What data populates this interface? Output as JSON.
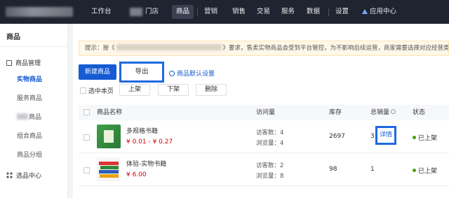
{
  "topnav": {
    "items": [
      "工作台",
      "门店",
      "商品",
      "营销",
      "销售",
      "交易",
      "服务",
      "数据",
      "设置",
      "应用中心"
    ],
    "active": "商品"
  },
  "sidebar": {
    "title": "商品",
    "group1": "商品管理",
    "items": [
      "实物商品",
      "服务商品",
      "商品",
      "组合商品",
      "商品分组"
    ],
    "group2": "选品中心"
  },
  "notice": {
    "prefix": "提示：按《",
    "suffix": "》要求，售卖实物商品会受到平台管控，为不影响后续运营，商家需要选择对应经营类目，特殊类目需"
  },
  "toolbar": {
    "new_label": "新建商品",
    "export_label": "导出",
    "settings_label": "商品默认设置",
    "select_page_label": "选中本页",
    "shelve_label": "上架",
    "unshelve_label": "下架",
    "delete_label": "删除"
  },
  "table": {
    "headers": {
      "name": "商品名称",
      "visits": "访问量",
      "stock": "库存",
      "sales": "总销量",
      "status": "状态"
    },
    "rows": [
      {
        "name": "多规格书籍",
        "price": "¥ 0.01 - ¥ 0.27",
        "visitors": "访客数：4",
        "views": "浏览量：4",
        "stock": "2697",
        "sales": "3",
        "detail": "详情",
        "status": "已上架"
      },
      {
        "name": "体验-实物书籍",
        "price": "¥ 6.00",
        "visitors": "访客数：2",
        "views": "浏览量：8",
        "stock": "98",
        "sales": "1",
        "status": "已上架"
      }
    ]
  },
  "colors": {
    "accent": "#155bd4",
    "highlight_border": "#1f6ae0",
    "price": "#d40000",
    "status_green": "#45a110",
    "topbar": "#1f2430"
  }
}
